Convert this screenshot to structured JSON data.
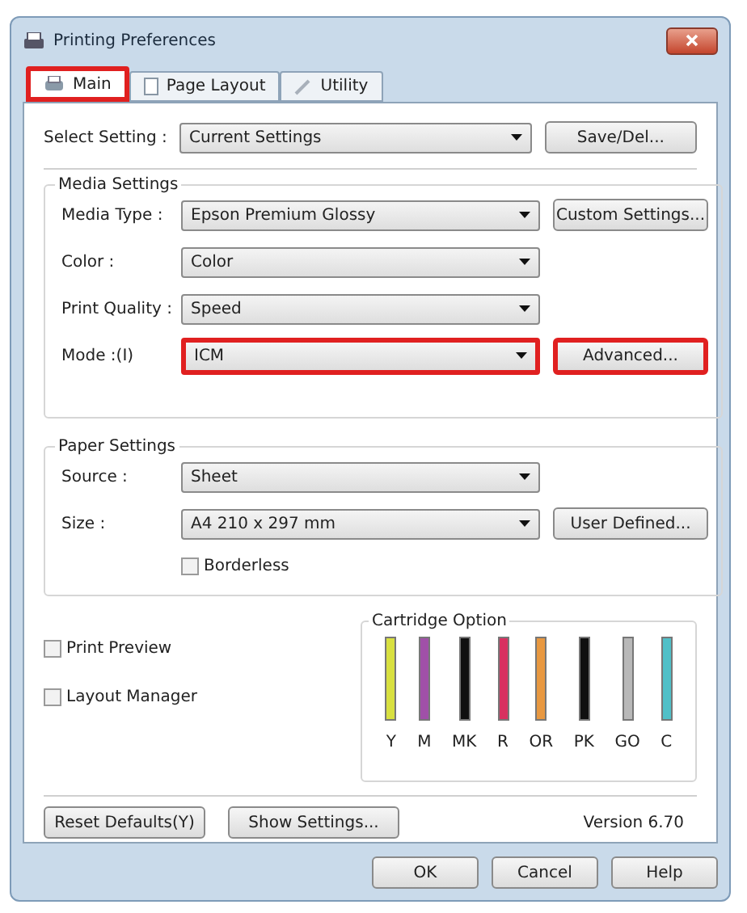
{
  "window": {
    "title": "Printing Preferences"
  },
  "tabs": [
    {
      "label": "Main",
      "selected": true,
      "highlighted": true
    },
    {
      "label": "Page Layout",
      "selected": false,
      "highlighted": false
    },
    {
      "label": "Utility",
      "selected": false,
      "highlighted": false
    }
  ],
  "select_setting": {
    "label": "Select Setting :",
    "value": "Current Settings",
    "button": "Save/Del..."
  },
  "media_settings": {
    "title": "Media Settings",
    "rows": [
      {
        "label": "Media Type :",
        "value": "Epson Premium Glossy",
        "highlighted": false,
        "button": {
          "label": "Custom Settings...",
          "highlighted": false
        }
      },
      {
        "label": "Color :",
        "value": "Color",
        "highlighted": false
      },
      {
        "label": "Print Quality :",
        "value": "Speed",
        "highlighted": false
      },
      {
        "label": "Mode :(I)",
        "value": "ICM",
        "highlighted": true,
        "button": {
          "label": "Advanced...",
          "highlighted": true
        }
      }
    ]
  },
  "paper_settings": {
    "title": "Paper Settings",
    "rows": [
      {
        "label": "Source :",
        "value": "Sheet"
      },
      {
        "label": "Size :",
        "value": "A4 210 x 297 mm",
        "button": {
          "label": "User Defined..."
        }
      }
    ],
    "borderless": {
      "label": "Borderless",
      "checked": false
    }
  },
  "options": [
    {
      "label": "Print Preview",
      "checked": false
    },
    {
      "label": "Layout Manager",
      "checked": false
    }
  ],
  "cartridge_option": {
    "title": "Cartridge Option",
    "cartridges": [
      {
        "label": "Y",
        "color": "#d8e040"
      },
      {
        "label": "M",
        "color": "#a050a8"
      },
      {
        "label": "MK",
        "color": "#101010"
      },
      {
        "label": "R",
        "color": "#d83060"
      },
      {
        "label": "OR",
        "color": "#e89840"
      },
      {
        "label": "PK",
        "color": "#101010"
      },
      {
        "label": "GO",
        "color": "#b8b8b8"
      },
      {
        "label": "C",
        "color": "#50c0c8"
      }
    ]
  },
  "bottom": {
    "reset": "Reset Defaults(Y)",
    "show": "Show Settings...",
    "version": "Version 6.70"
  },
  "buttons": [
    "OK",
    "Cancel",
    "Help"
  ]
}
